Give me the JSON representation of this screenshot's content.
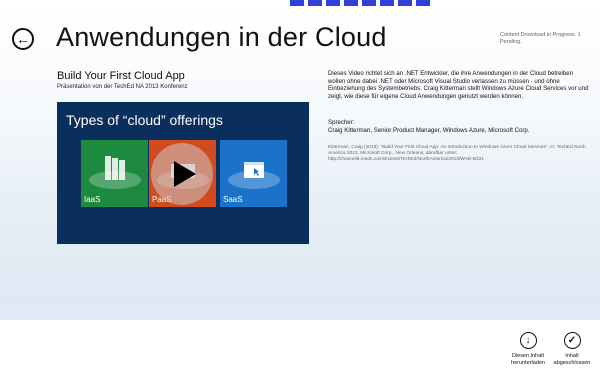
{
  "app": {
    "title": "Anwendungen in der Cloud",
    "status": "Content Download in Progress. 1 Pending."
  },
  "content": {
    "heading": "Build Your First Cloud App",
    "subheading": "Präsentation von der TechEd NA 2013 Konferenz",
    "video": {
      "title": "Types of “cloud” offerings",
      "tiles": [
        {
          "label": "IaaS",
          "color": "#1e8a3f"
        },
        {
          "label": "PaaS",
          "color": "#d24b1e"
        },
        {
          "label": "SaaS",
          "color": "#1a73c9"
        }
      ]
    },
    "description": "Dieses Video richtet sich an .NET Entwickler, die ihre Anwendungen in der Cloud betreiben wollen ohne dabei .NET oder Microsoft Visual Studio verlassen zu müssen - und ohne Einbeziehung des Systembetriebs. Craig Kitterman stellt Windows Azure Cloud Services vor und zeigt, wie diese für eigene Cloud Anwendungen genutzt werden können.",
    "speaker_label": "Sprecher:",
    "speaker": "Craig Kitterman, Senior Product Manager, Windows Azure, Microsoft Corp.",
    "citation": "Kitterman, Craig (2013): \"Build Your First Cloud App: An Introduction to Windows Azure Cloud Services\", in: TechEd North America 2013, Microsoft Corp., New Orleans, abrufbar unter: http://channel9.msdn.com/Events/TechEd/NorthAmerica/2013/WAD-B321"
  },
  "appbar": {
    "download_line1": "Diesen Inhalt",
    "download_line2": "herunterladen",
    "complete_line1": "Inhalt",
    "complete_line2": "abgeschlossen"
  },
  "colors": {
    "video_bg": "#0b2f5c",
    "accent_strip": "#2f3fd8"
  }
}
